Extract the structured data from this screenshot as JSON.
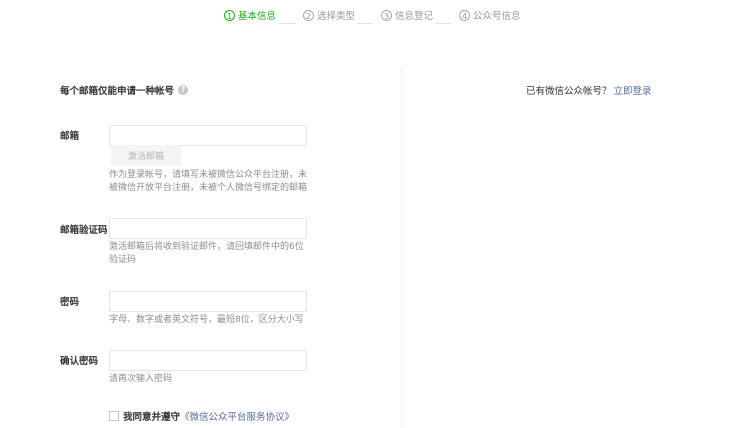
{
  "steps": [
    {
      "num": "1",
      "label": "基本信息",
      "active": true
    },
    {
      "num": "2",
      "label": "选择类型",
      "active": false
    },
    {
      "num": "3",
      "label": "信息登记",
      "active": false
    },
    {
      "num": "4",
      "label": "公众号信息",
      "active": false
    }
  ],
  "form": {
    "tip": "每个邮箱仅能申请一种帐号",
    "email": {
      "label": "邮箱",
      "value": "",
      "activate_button": "激活邮箱",
      "hint": "作为登录帐号，请填写未被微信公众平台注册，未被微信开放平台注册，未被个人微信号绑定的邮箱"
    },
    "code": {
      "label": "邮箱验证码",
      "value": "",
      "hint": "激活邮箱后将收到验证邮件，请回填邮件中的6位验证码"
    },
    "password": {
      "label": "密码",
      "value": "",
      "hint": "字母、数字或者英文符号，最短8位，区分大小写"
    },
    "confirm": {
      "label": "确认密码",
      "value": "",
      "hint": "请再次输入密码"
    },
    "agree": {
      "checked": false,
      "text": "我同意并遵守",
      "link": "《微信公众平台服务协议》"
    }
  },
  "side": {
    "prompt": "已有微信公众帐号？",
    "login_link": "立即登录"
  },
  "colors": {
    "accent_green": "#1aad19",
    "link_blue": "#576b95"
  }
}
